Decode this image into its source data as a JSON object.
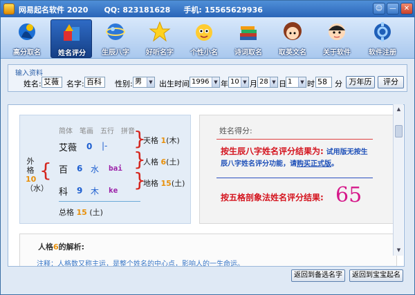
{
  "window": {
    "title": "网易起名软件 2020",
    "qq_label": "QQ:",
    "qq": "823181628",
    "phone_label": "手机:",
    "phone": "15565629936",
    "buttons": [
      "☺",
      "—",
      "✕"
    ]
  },
  "toolbar": [
    {
      "label": "高分取名",
      "icon": "sculpture-icon",
      "active": false
    },
    {
      "label": "姓名评分",
      "icon": "shapes-icon",
      "active": true
    },
    {
      "label": "生辰八字",
      "icon": "globe-icon",
      "active": false
    },
    {
      "label": "好听名字",
      "icon": "star-icon",
      "active": false
    },
    {
      "label": "个性小名",
      "icon": "cartoon-face-icon",
      "active": false
    },
    {
      "label": "诗词取名",
      "icon": "books-icon",
      "active": false
    },
    {
      "label": "取英文名",
      "icon": "girl-face-icon",
      "active": false
    },
    {
      "label": "关于软件",
      "icon": "cartoon-boy-icon",
      "active": false
    },
    {
      "label": "软件注册",
      "icon": "gear-globe-icon",
      "active": false
    }
  ],
  "input_panel": {
    "title": "输入资料",
    "surname_label": "姓名:",
    "surname": "艾薇",
    "given_label": "名字:",
    "given": "百科",
    "gender_label": "性别:",
    "gender": "男",
    "birth_label": "出生时间:",
    "year": "1996",
    "year_unit": "年",
    "month": "10",
    "month_unit": "月",
    "day": "28",
    "day_unit": "日",
    "hour": "1",
    "hour_unit": "时",
    "minute": "58",
    "minute_unit": "分",
    "calendar_button": "万年历",
    "score_button": "评分"
  },
  "grid": {
    "headers": [
      "简体",
      "笔画",
      "五行",
      "拼音"
    ],
    "rows": [
      {
        "char": "艾薇",
        "strokes": "0",
        "element": "|-",
        "pinyin": ""
      },
      {
        "char": "百",
        "strokes": "6",
        "element": "水",
        "pinyin": "bai"
      },
      {
        "char": "科",
        "strokes": "9",
        "element": "木",
        "pinyin": "ke"
      }
    ],
    "waige_label": "外格",
    "waige_num": "10",
    "waige_element": "（水）",
    "tiange_label": "天格",
    "tiange_num": "1",
    "tiange_element": "(木)",
    "renge_label": "人格",
    "renge_num": "6",
    "renge_element": "(土)",
    "dige_label": "地格",
    "dige_num": "15",
    "dige_element": "(土)",
    "zongge_label": "总格",
    "zongge_num": "15",
    "zongge_element": "(土)"
  },
  "score": {
    "title": "姓名得分:",
    "bazi_red": "按生辰八字姓名评分结果为:",
    "bazi_blue_1": "试用版无按生",
    "bazi_blue_2": "辰八字姓名评分功能，请",
    "bazi_link": "购买正式版",
    "bazi_end": "。",
    "wuge_label": "按五格剖象法姓名评分结果:",
    "wuge_score": "65"
  },
  "analysis": {
    "title_pre": "人格",
    "title_num": "6",
    "title_post": "的解析:",
    "note": "注释：人格数又称主运，是整个姓名的中心点，影响人的一生命运。"
  },
  "bottom_buttons": {
    "back_candidates": "返回到备选名字",
    "back_baby": "返回到宝宝起名"
  },
  "colors": {
    "titlebar": "#2a65b8",
    "accent_red": "#d4141e",
    "accent_blue": "#1d4fb8",
    "score_magenta": "#d6188a",
    "number_orange": "#e8900a"
  }
}
